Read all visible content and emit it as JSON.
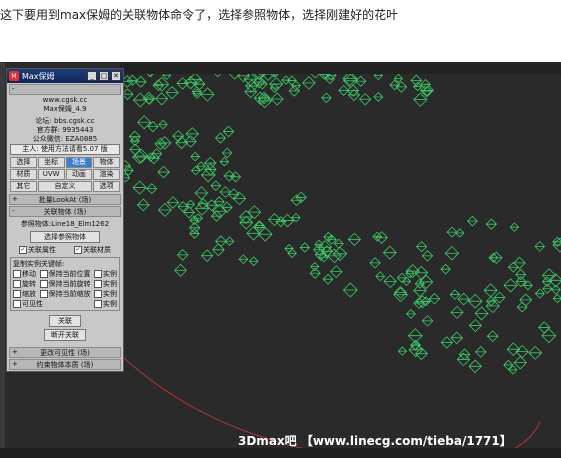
{
  "caption": "这下要用到max保姆的关联物体命令了，选择参照物体，选择刚建好的花叶",
  "window": {
    "title": "Max保姆",
    "min_label": "_",
    "max_label": "□",
    "close_label": "✕"
  },
  "panel": {
    "header": "",
    "site": "www.cgsk.cc",
    "version": "Max保姆_4.9",
    "forum": "论坛: bbs.cgsk.cc",
    "qq_group": "官方群: 9935443",
    "wechat": "公众微信: EZA0885",
    "banner": "主人: 使用方法请看5.07 版",
    "tabs": [
      {
        "label": "选择",
        "active": false
      },
      {
        "label": "坐标",
        "active": false
      },
      {
        "label": "场景",
        "active": true
      },
      {
        "label": "物体",
        "active": false
      },
      {
        "label": "材质",
        "active": false
      },
      {
        "label": "UVW",
        "active": false
      },
      {
        "label": "动画",
        "active": false
      },
      {
        "label": "渲染",
        "active": false
      },
      {
        "label": "其它",
        "active": false
      },
      {
        "label": "自定义",
        "active": false
      },
      {
        "label": "选项",
        "active": false
      }
    ],
    "rollouts": {
      "lookat": "批量LookAt (场)",
      "link": "关联物体 (场)",
      "visibility": "更改可见性 (场)",
      "constraint": "约束物体本质 (场)"
    },
    "ref_object_label": "参照物体:Line18_Elm1262",
    "pick_button": "选择参照物体",
    "link_attr": "关联属性",
    "link_material": "关联材质",
    "copy_section_label": "复制实例关键帧:",
    "rows": [
      {
        "left": "移动",
        "mid": "保持当前位置",
        "right": "实例"
      },
      {
        "left": "旋转",
        "mid": "保持当前旋转",
        "right": "实例"
      },
      {
        "left": "缩放",
        "mid": "保持当前缩放",
        "right": "实例"
      },
      {
        "left": "可见性",
        "mid": "",
        "right": "实例"
      }
    ],
    "link_button": "关联",
    "unlink_button": "断开关联"
  },
  "watermark": "3Dmax吧 【www.linecg.com/tieba/1771】",
  "colors": {
    "leaf": "#3ec96a",
    "curve": "#b53333",
    "viewport": "#2a2a2a",
    "tab_active": "#3c7fcf"
  }
}
